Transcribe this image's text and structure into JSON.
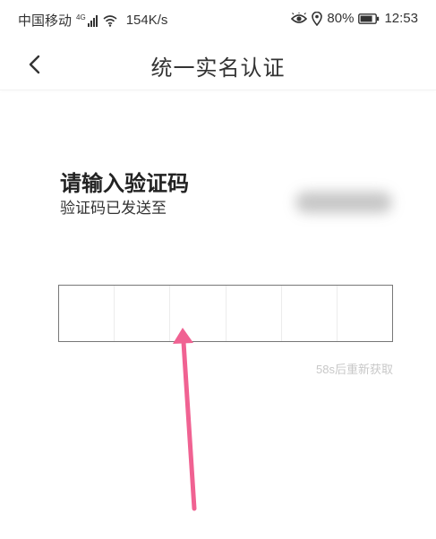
{
  "status_bar": {
    "carrier": "中国移动",
    "network_tag": "4G",
    "speed": "154K/s",
    "battery": "80%",
    "time": "12:53"
  },
  "nav": {
    "title": "统一实名认证",
    "back_icon": "chevron-left-icon"
  },
  "verification": {
    "heading": "请输入验证码",
    "sent_to": "验证码已发送至",
    "code_length": 6,
    "resend_countdown": "58s后重新获取"
  },
  "colors": {
    "arrow": "#f06292",
    "input_border": "#777777",
    "countdown_text": "#c8c8c8"
  }
}
